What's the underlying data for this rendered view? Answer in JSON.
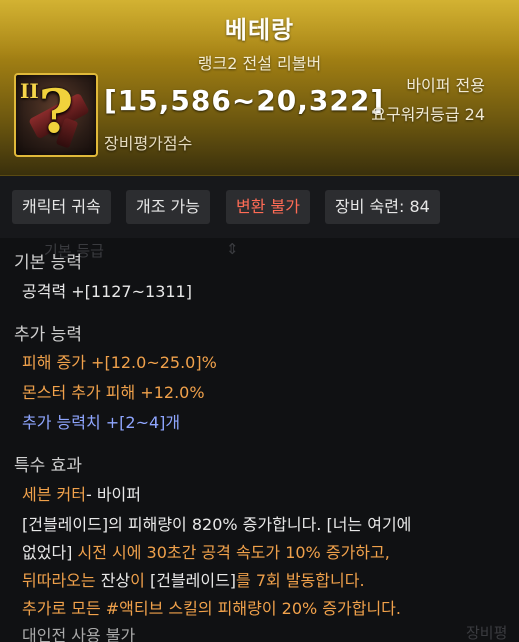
{
  "item": {
    "name": "베테랑",
    "subtitle": "랭크2 전설 리볼버",
    "rank_badge": "II",
    "icon_glyph": "?",
    "damage_range": "[15,586~20,322]",
    "score_label": "장비평가점수",
    "class_only": "바이퍼 전용",
    "required_level": "요구워커등급 24"
  },
  "tags": [
    {
      "label": "캐릭터 귀속"
    },
    {
      "label": "개조 가능"
    },
    {
      "label": "변환 불가"
    },
    {
      "label": "장비 숙련: 84"
    }
  ],
  "background_ghost": {
    "sort_label": "기본 등급",
    "corner_label": "장비평"
  },
  "basic": {
    "title": "기본 능력",
    "line": "공격력  +[1127~1311]"
  },
  "additional": {
    "title": "추가 능력",
    "line1": "피해 증가  +[12.0~25.0]%",
    "line2": "몬스터 추가 피해  +12.0%",
    "line3": "추가 능력치 +[2~4]개"
  },
  "special": {
    "title": "특수 효과",
    "set_name": "세븐 커터",
    "set_class": "- 바이퍼",
    "desc": {
      "l1_a": "[건블레이드]의 피해량이 820% 증가합니다. [너는 여기에",
      "l2_a": "없었다]",
      "l2_b": " 시전 시에 30초간 공격 속도가 10% 증가하고,",
      "l3_a": "뒤따라오는 ",
      "l3_b": "잔상",
      "l3_c": "이 ",
      "l3_d": "[건블레이드]",
      "l3_e": "를 7회 발동합니다.",
      "l4": "추가로 모든 #액티브 스킬의 피해량이 20% 증가합니다."
    },
    "pvp_note": "대인전 사용 불가"
  },
  "colors": {
    "header_gold": "#c9a41a",
    "orange_text": "#f0a14b",
    "blue_text": "#8fa6ff",
    "red_tag": "#ff6b55"
  }
}
